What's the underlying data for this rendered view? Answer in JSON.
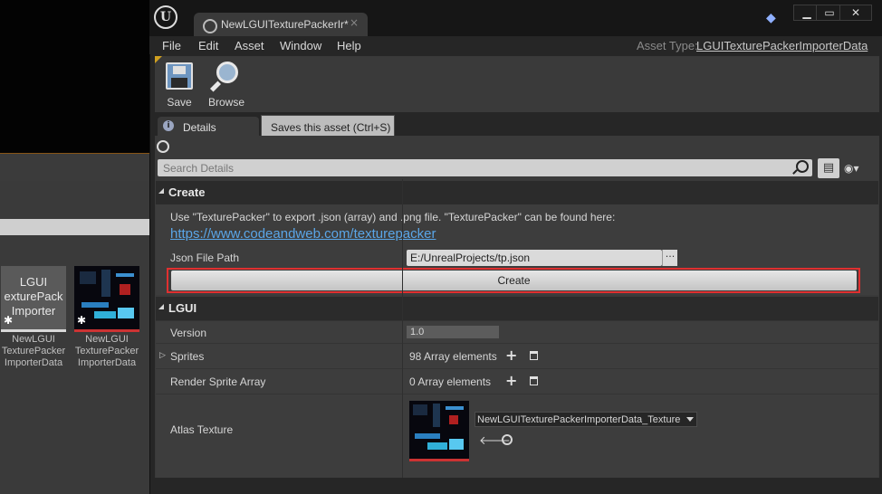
{
  "background_browser": {
    "assets": [
      {
        "thumb_text": "LGUI\nexturePack\nImporter",
        "name": "NewLGUI\nTexturePacker\nImporterData"
      },
      {
        "thumb_text": "",
        "name": "NewLGUI\nTexturePacker\nImporterData"
      }
    ]
  },
  "window": {
    "tab_label": "NewLGUITexturePackerIr*",
    "close_glyph": "×",
    "controls": {
      "minimize": "▁",
      "maximize": "▭",
      "close": "✕"
    }
  },
  "menu": {
    "items": [
      "File",
      "Edit",
      "Asset",
      "Window",
      "Help"
    ],
    "asset_type_label": "Asset Type:",
    "asset_type_value": "LGUITexturePackerImporterData"
  },
  "toolbar": {
    "save_label": "Save",
    "browse_label": "Browse"
  },
  "details": {
    "tab_label": "Details",
    "tooltip": "Saves this asset (Ctrl+S)",
    "search_placeholder": "Search Details"
  },
  "create_section": {
    "title": "Create",
    "description": "Use \"TexturePacker\" to export .json (array) and .png file. \"TexturePacker\" can be found here:",
    "link": "https://www.codeandweb.com/texturepacker",
    "json_path_label": "Json File Path",
    "json_path_value": "E:/UnrealProjects/tp.json",
    "browse_dots": "···",
    "create_button": "Create"
  },
  "lgui_section": {
    "title": "LGUI",
    "version_label": "Version",
    "version_value": "1.0",
    "sprites_label": "Sprites",
    "sprites_value": "98 Array elements",
    "render_sprite_label": "Render Sprite Array",
    "render_sprite_value": "0 Array elements",
    "atlas_label": "Atlas Texture",
    "atlas_value": "NewLGUITexturePackerImporterData_Texture"
  },
  "colors": {
    "highlight_outline": "#e03030",
    "link": "#5aa6e8",
    "thumb_underline": "#cc3333"
  }
}
